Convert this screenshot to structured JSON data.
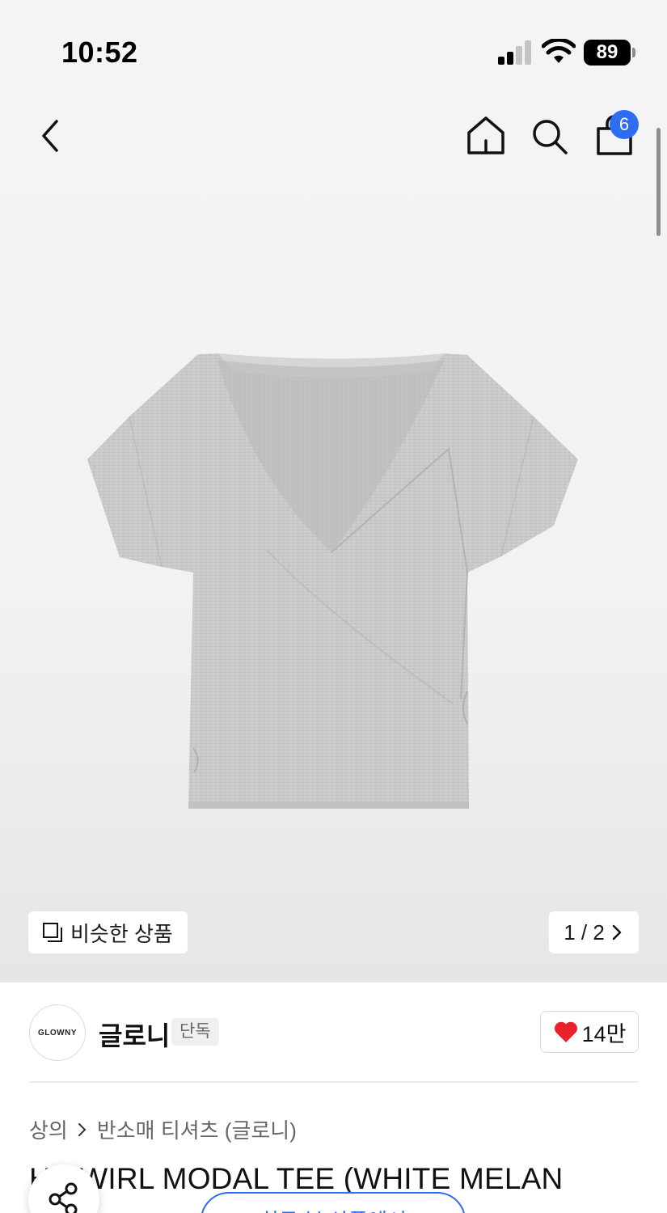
{
  "status_bar": {
    "time": "10:52",
    "battery": "89"
  },
  "header": {
    "cart_count": "6"
  },
  "gallery": {
    "similar_label": "비슷한 상품",
    "pager": "1 / 2"
  },
  "brand": {
    "logo_text": "GLOWNY",
    "name": "글로니",
    "tag": "단독",
    "like_count": "14만"
  },
  "breadcrumb": [
    "상의",
    "반소매 티셔츠 (글로니)"
  ],
  "product": {
    "title": "H SWIRL MODAL TEE (WHITE MELAN"
  },
  "floating": {
    "recent_pill": "최근 본 상품에서"
  },
  "colors": {
    "accent": "#2f6cf4",
    "heart": "#e8222c"
  }
}
